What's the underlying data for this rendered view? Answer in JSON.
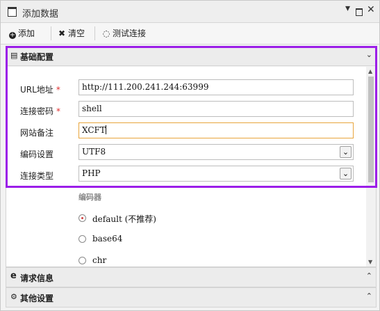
{
  "window": {
    "title": "添加数据"
  },
  "toolbar": {
    "add_label": "添加",
    "clear_label": "清空",
    "test_label": "测试连接"
  },
  "basic": {
    "title": "基础配置",
    "url_label": "URL地址",
    "url_value": "http://111.200.241.244:63999",
    "password_label": "连接密码",
    "password_value": "shell",
    "note_label": "网站备注",
    "note_value": "XCFT",
    "encoding_label": "编码设置",
    "encoding_value": "UTF8",
    "type_label": "连接类型",
    "type_value": "PHP",
    "encoder_label": "编码器",
    "encoders": [
      {
        "label": "default (不推荐)",
        "selected": true
      },
      {
        "label": "base64",
        "selected": false
      },
      {
        "label": "chr",
        "selected": false
      }
    ]
  },
  "request": {
    "title": "请求信息"
  },
  "other": {
    "title": "其他设置"
  },
  "required_mark": "*",
  "colors": {
    "highlight": "#9b1ee8",
    "required": "#e03030",
    "focus": "#e8a53c"
  }
}
